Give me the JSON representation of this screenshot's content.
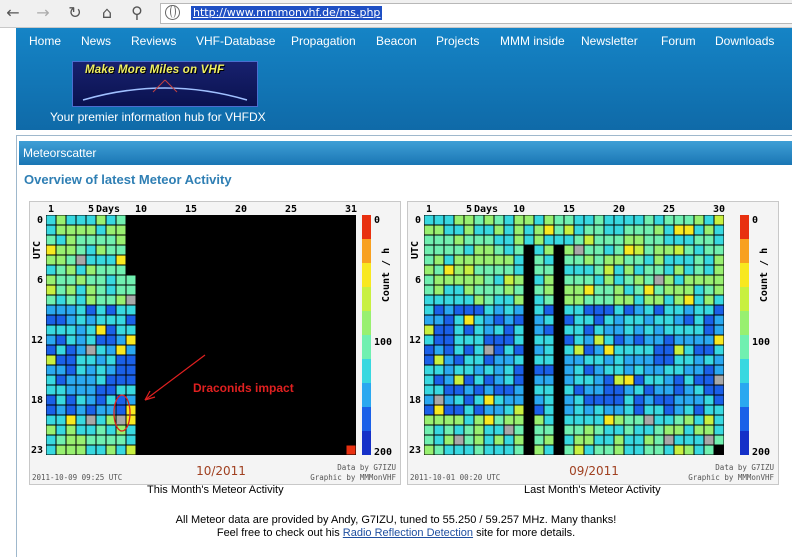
{
  "browser": {
    "url": "http://www.mmmonvhf.de/ms.php"
  },
  "nav": {
    "items": [
      "Home",
      "News",
      "Reviews",
      "VHF-Database",
      "Propagation",
      "Beacon",
      "Projects",
      "MMM inside",
      "Newsletter",
      "Forum",
      "Downloads"
    ]
  },
  "logo": {
    "text": "Make More Miles on VHF"
  },
  "tagline": "Your premier information hub for VHFDX",
  "section": {
    "title": "Meteorscatter"
  },
  "heading": "Overview of latest Meteor Activity",
  "annotation": "Draconids impact",
  "colors": {
    "scale": [
      "#1530c8",
      "#1a60e8",
      "#2aa8f0",
      "#38d8e0",
      "#70f0b0",
      "#98f070",
      "#c8f040",
      "#f8e820",
      "#f8a020",
      "#e83010"
    ]
  },
  "charts": [
    {
      "title": "This Month's Meteor Activity",
      "period": "10/2011",
      "timestamp": "2011-10-09 09:25 UTC",
      "credit_data": "Data by G7IZU",
      "credit_graphic": "Graphic by MMMonVHF",
      "x_label": "Days",
      "y_label": "UTC",
      "z_label": "Count / h",
      "x_ticks": [
        "1",
        "5",
        "10",
        "15",
        "20",
        "25",
        "31"
      ],
      "y_ticks": [
        "0",
        "6",
        "12",
        "18",
        "23"
      ],
      "z_ticks": [
        "0",
        "100",
        "200"
      ],
      "days": 31,
      "filled_days": 9
    },
    {
      "title": "Last Month's Meteor Activity",
      "period": "09/2011",
      "timestamp": "2011-10-01 00:20 UTC",
      "credit_data": "Data by G7IZU",
      "credit_graphic": "Graphic by MMMonVHF",
      "x_label": "Days",
      "y_label": "UTC",
      "z_label": "Count / h",
      "x_ticks": [
        "1",
        "5",
        "10",
        "15",
        "20",
        "25",
        "30"
      ],
      "y_ticks": [
        "0",
        "6",
        "12",
        "18",
        "23"
      ],
      "z_ticks": [
        "0",
        "100",
        "200"
      ],
      "days": 30,
      "filled_days": 30
    }
  ],
  "footer": {
    "line1": "All Meteor data are provided by Andy, G7IZU, tuned to 55.250 / 59.257 MHz. Many thanks!",
    "line2_pre": "Feel free to check out his ",
    "link": "Radio Reflection Detection",
    "line2_post": " site for more details."
  }
}
